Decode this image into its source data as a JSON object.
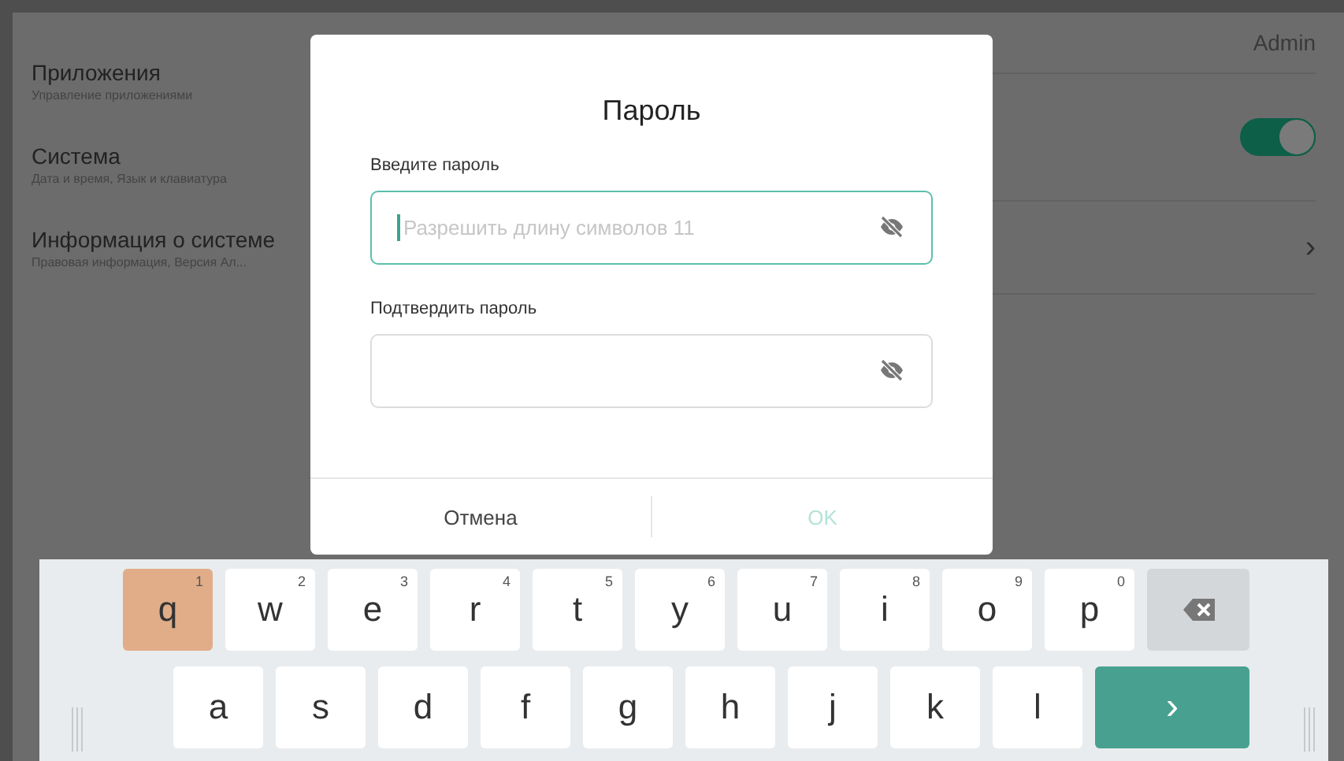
{
  "sidebar": {
    "items": [
      {
        "title": "Приложения",
        "subtitle": "Управление приложениями"
      },
      {
        "title": "Система",
        "subtitle": "Дата и время, Язык и клавиатура"
      },
      {
        "title": "Информация о системе",
        "subtitle": "Правовая информация, Версия Ал..."
      }
    ]
  },
  "panel": {
    "user": "Admin",
    "toggle_on": true,
    "chevron": "›"
  },
  "dialog": {
    "title": "Пароль",
    "fields": [
      {
        "label": "Введите пароль",
        "placeholder": "Разрешить длину символов 11",
        "focused": true
      },
      {
        "label": "Подтвердить пароль",
        "focused": false
      }
    ],
    "buttons": [
      {
        "label": "Отмена",
        "disabled": false
      },
      {
        "label": "OK",
        "disabled": true
      }
    ]
  },
  "keyboard": {
    "rows": [
      [
        {
          "kind": "char",
          "label": "q",
          "hint": "1",
          "pressed": true
        },
        {
          "kind": "char",
          "label": "w",
          "hint": "2",
          "pressed": false
        },
        {
          "kind": "char",
          "label": "e",
          "hint": "3",
          "pressed": false
        },
        {
          "kind": "char",
          "label": "r",
          "hint": "4",
          "pressed": false
        },
        {
          "kind": "char",
          "label": "t",
          "hint": "5",
          "pressed": false
        },
        {
          "kind": "char",
          "label": "y",
          "hint": "6",
          "pressed": false
        },
        {
          "kind": "char",
          "label": "u",
          "hint": "7",
          "pressed": false
        },
        {
          "kind": "char",
          "label": "i",
          "hint": "8",
          "pressed": false
        },
        {
          "kind": "char",
          "label": "o",
          "hint": "9",
          "pressed": false
        },
        {
          "kind": "char",
          "label": "p",
          "hint": "0",
          "pressed": false
        },
        {
          "kind": "backspace"
        }
      ],
      [
        {
          "kind": "char",
          "label": "a",
          "pressed": false
        },
        {
          "kind": "char",
          "label": "s",
          "pressed": false
        },
        {
          "kind": "char",
          "label": "d",
          "pressed": false
        },
        {
          "kind": "char",
          "label": "f",
          "pressed": false
        },
        {
          "kind": "char",
          "label": "g",
          "pressed": false
        },
        {
          "kind": "char",
          "label": "h",
          "pressed": false
        },
        {
          "kind": "char",
          "label": "j",
          "pressed": false
        },
        {
          "kind": "char",
          "label": "k",
          "pressed": false
        },
        {
          "kind": "char",
          "label": "l",
          "pressed": false
        },
        {
          "kind": "enter",
          "label": "›"
        }
      ]
    ]
  }
}
